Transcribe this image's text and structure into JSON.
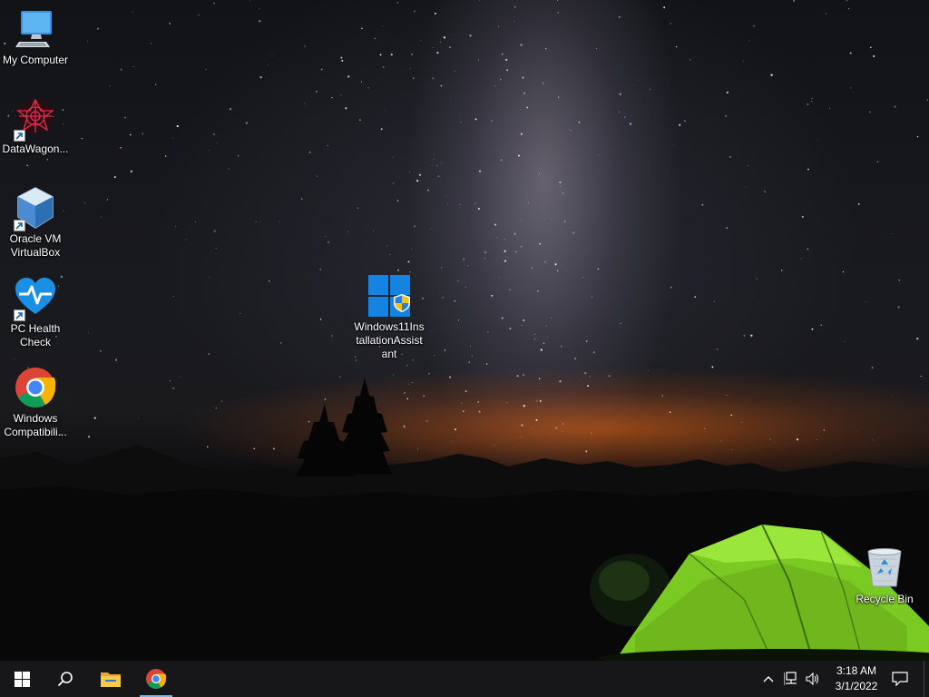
{
  "desktop": {
    "icons": [
      {
        "name": "my-computer",
        "label": "My Computer"
      },
      {
        "name": "datawagon",
        "label": "DataWagon..."
      },
      {
        "name": "oracle-vm-virtualbox",
        "label": "Oracle VM VirtualBox"
      },
      {
        "name": "pc-health-check",
        "label": "PC Health Check"
      },
      {
        "name": "windows-compatibility",
        "label": "Windows Compatibili..."
      },
      {
        "name": "windows11-installation-assistant",
        "label": "Windows11InstallationAssistant"
      },
      {
        "name": "recycle-bin",
        "label": "Recycle Bin"
      }
    ]
  },
  "taskbar": {
    "start": {
      "icon": "windows-logo-icon"
    },
    "search": {
      "icon": "search-icon"
    },
    "pinned": [
      {
        "name": "file-explorer",
        "icon": "folder-icon"
      },
      {
        "name": "chrome",
        "icon": "chrome-icon",
        "active": true
      }
    ],
    "tray": {
      "icons": [
        "chevron-up-icon",
        "network-icon",
        "volume-icon"
      ],
      "time": "3:18 AM",
      "date": "3/1/2022",
      "notification_icon": "action-center-icon"
    }
  },
  "colors": {
    "taskbar_bg": "#101012",
    "active_indicator": "#76b9ed",
    "tent_green": "#8fe02a",
    "sunset_orange": "#ff6e14"
  }
}
